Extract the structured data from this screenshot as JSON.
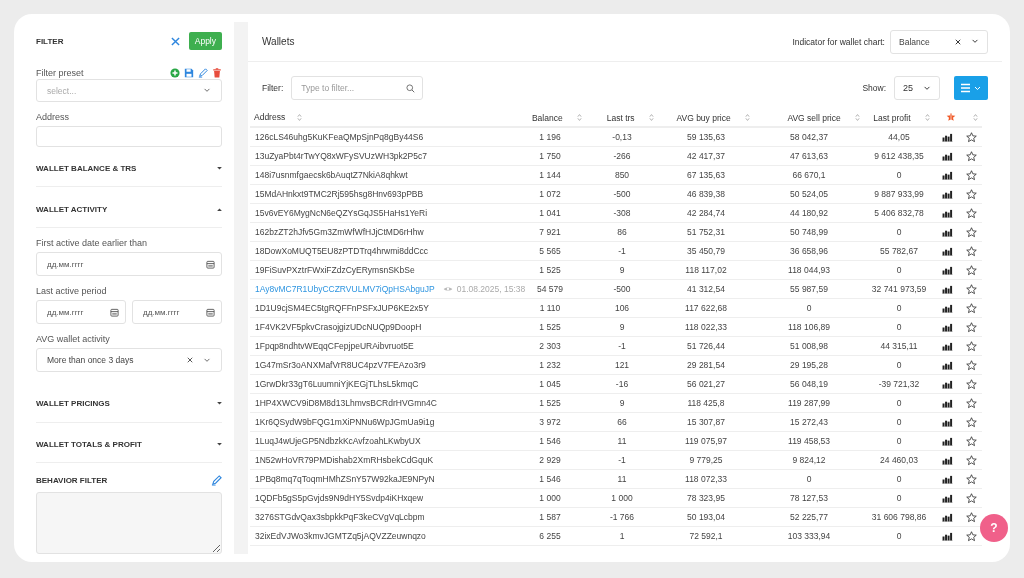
{
  "filter_panel": {
    "title": "FILTER",
    "apply": "Apply",
    "preset": {
      "label": "Filter preset",
      "placeholder": "select..."
    },
    "address": {
      "label": "Address"
    },
    "sections": [
      {
        "title": "WALLET BALANCE & TRS",
        "expanded": false
      },
      {
        "title": "WALLET ACTIVITY",
        "expanded": true,
        "fields": [
          {
            "kind": "date",
            "label": "First active date earlier than",
            "inputs": [
              {
                "placeholder": "дд.мм.гггг"
              }
            ]
          },
          {
            "kind": "date",
            "label": "Last active period",
            "inputs": [
              {
                "placeholder": "дд.мм.гггг"
              },
              {
                "placeholder": "дд.мм.гггг"
              }
            ]
          },
          {
            "kind": "select",
            "label": "AVG wallet activity",
            "value": "More than once 3 days"
          }
        ]
      },
      {
        "title": "WALLET PRICINGS",
        "expanded": false
      },
      {
        "title": "WALLET TOTALS & PROFIT",
        "expanded": false
      }
    ],
    "behavior": {
      "title": "BEHAVIOR FILTER"
    }
  },
  "wallets": {
    "title": "Wallets",
    "indicator": {
      "label": "Indicator for wallet chart:",
      "value": "Balance"
    },
    "filter": {
      "label": "Filter:",
      "placeholder": "Type to filter..."
    },
    "show": {
      "label": "Show:",
      "value": "25"
    },
    "columns": [
      "Address",
      "Balance",
      "Last trs",
      "AVG buy price",
      "AVG sell price",
      "Last profit"
    ],
    "rows": [
      {
        "address": "126cLS46uhg5KuKFeaQMpSjnPq8gBy44S6",
        "watched": false,
        "balance": "1 196",
        "last_trs": "-0,13",
        "avg_buy": "59 135,63",
        "avg_sell": "58 042,37",
        "last_profit": "44,05",
        "starred": false
      },
      {
        "address": "13uZyaPbt4rTwYQ8xWFySVUzWH3pk2P5c7",
        "watched": false,
        "balance": "1 750",
        "last_trs": "-266",
        "avg_buy": "42 417,37",
        "avg_sell": "47 613,63",
        "last_profit": "9 612 438,35",
        "starred": false
      },
      {
        "address": "148i7usnmfgaecsk6bAuqtZ7NkiA8qhkwt",
        "watched": false,
        "balance": "1 144",
        "last_trs": "850",
        "avg_buy": "67 135,63",
        "avg_sell": "66 670,1",
        "last_profit": "0",
        "starred": false
      },
      {
        "address": "15MdAHnkxt9TMC2Rj595hsg8Hnv693pPBB",
        "watched": false,
        "balance": "1 072",
        "last_trs": "-500",
        "avg_buy": "46 839,38",
        "avg_sell": "50 524,05",
        "last_profit": "9 887 933,99",
        "starred": false
      },
      {
        "address": "15v6vEY6MygNcN6eQZYsGqJS5HaHs1YeRi",
        "watched": false,
        "balance": "1 041",
        "last_trs": "-308",
        "avg_buy": "42 284,74",
        "avg_sell": "44 180,92",
        "last_profit": "5 406 832,78",
        "starred": false
      },
      {
        "address": "162bzZT2hJfv5Gm3ZmWfWfHJjCtMD6rHhw",
        "watched": false,
        "balance": "7 921",
        "last_trs": "86",
        "avg_buy": "51 752,31",
        "avg_sell": "50 748,99",
        "last_profit": "0",
        "starred": false
      },
      {
        "address": "18DowXoMUQT5EU8zPTDTrq4hrwmi8ddCcc",
        "watched": false,
        "balance": "5 565",
        "last_trs": "-1",
        "avg_buy": "35 450,79",
        "avg_sell": "36 658,96",
        "last_profit": "55 782,67",
        "starred": false
      },
      {
        "address": "19FiSuvPXztrFWxiFZdzCyERymsnSKbSe",
        "watched": false,
        "balance": "1 525",
        "last_trs": "9",
        "avg_buy": "118 117,02",
        "avg_sell": "118 044,93",
        "last_profit": "0",
        "starred": false
      },
      {
        "address": "1Ay8vMC7R1UbyCCZRVULMV7iQpHSAbguJP",
        "watched": true,
        "seen_at": "01.08.2025, 15:38",
        "balance": "54 579",
        "last_trs": "-500",
        "avg_buy": "41 312,54",
        "avg_sell": "55 987,59",
        "last_profit": "32 741 973,59",
        "starred": false
      },
      {
        "address": "1D1U9cjSM4EC5tgRQFFnPSFxJUP6KE2x5Y",
        "watched": false,
        "balance": "1 110",
        "last_trs": "106",
        "avg_buy": "117 622,68",
        "avg_sell": "0",
        "last_profit": "0",
        "starred": false
      },
      {
        "address": "1F4VK2VF5pkvCrasojgizUDcNUQp9DoopH",
        "watched": false,
        "balance": "1 525",
        "last_trs": "9",
        "avg_buy": "118 022,33",
        "avg_sell": "118 106,89",
        "last_profit": "0",
        "starred": false
      },
      {
        "address": "1Fpqp8ndhtvWEqqCFepjpeURAibvruot5E",
        "watched": false,
        "balance": "2 303",
        "last_trs": "-1",
        "avg_buy": "51 726,44",
        "avg_sell": "51 008,98",
        "last_profit": "44 315,11",
        "starred": false
      },
      {
        "address": "1G47mSr3oANXMafVrR8UC4pzV7FEAzo3r9",
        "watched": false,
        "balance": "1 232",
        "last_trs": "121",
        "avg_buy": "29 281,54",
        "avg_sell": "29 195,28",
        "last_profit": "0",
        "starred": false
      },
      {
        "address": "1GrwDkr33gT6LuumniYjKEGjTLhsL5kmqC",
        "watched": false,
        "balance": "1 045",
        "last_trs": "-16",
        "avg_buy": "56 021,27",
        "avg_sell": "56 048,19",
        "last_profit": "-39 721,32",
        "starred": false
      },
      {
        "address": "1HP4XWCV9iD8M8d13LhmvsBCRdrHVGmn4C",
        "watched": false,
        "balance": "1 525",
        "last_trs": "9",
        "avg_buy": "118 425,8",
        "avg_sell": "119 287,99",
        "last_profit": "0",
        "starred": false
      },
      {
        "address": "1Kr6QSydW9bFQG1mXiPNNu6WpJGmUa9i1g",
        "watched": false,
        "balance": "3 972",
        "last_trs": "66",
        "avg_buy": "15 307,87",
        "avg_sell": "15 272,43",
        "last_profit": "0",
        "starred": false
      },
      {
        "address": "1LuqJ4wUjeGP5NdbzkKcAvfzoahLKwbyUX",
        "watched": false,
        "balance": "1 546",
        "last_trs": "11",
        "avg_buy": "119 075,97",
        "avg_sell": "119 458,53",
        "last_profit": "0",
        "starred": false
      },
      {
        "address": "1N52wHoVR79PMDishab2XmRHsbekCdGquK",
        "watched": false,
        "balance": "2 929",
        "last_trs": "-1",
        "avg_buy": "9 779,25",
        "avg_sell": "9 824,12",
        "last_profit": "24 460,03",
        "starred": false
      },
      {
        "address": "1PBq8mq7qToqmHMhZSnY57W92kaJE9NPyN",
        "watched": false,
        "balance": "1 546",
        "last_trs": "11",
        "avg_buy": "118 072,33",
        "avg_sell": "0",
        "last_profit": "0",
        "starred": false
      },
      {
        "address": "1QDFb5gS5pGvjds9N9dHY5Svdp4iKHxqew",
        "watched": false,
        "balance": "1 000",
        "last_trs": "1 000",
        "avg_buy": "78 323,95",
        "avg_sell": "78 127,53",
        "last_profit": "0",
        "starred": false
      },
      {
        "address": "3276STGdvQax3sbpkkPqF3keCVgVqLcbpm",
        "watched": false,
        "balance": "1 587",
        "last_trs": "-1 766",
        "avg_buy": "50 193,04",
        "avg_sell": "52 225,77",
        "last_profit": "31 606 798,86",
        "starred": false
      },
      {
        "address": "32ixEdVJWo3kmvJGMTZq5jAQVZZeuwnqzo",
        "watched": false,
        "balance": "6 255",
        "last_trs": "1",
        "avg_buy": "72 592,1",
        "avg_sell": "103 333,94",
        "last_profit": "0",
        "starred": false
      }
    ]
  },
  "help_button": "?"
}
